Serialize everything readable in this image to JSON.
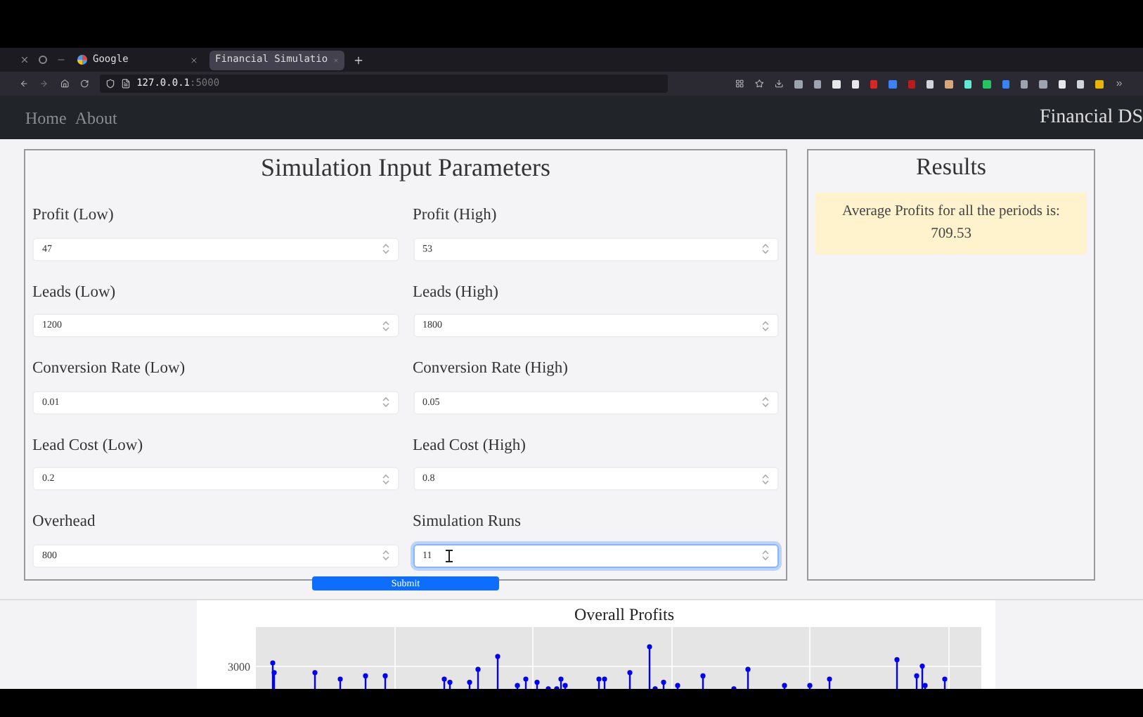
{
  "browser": {
    "tabs": [
      {
        "label": "Google",
        "selected": false
      },
      {
        "label": "Financial Simulatio",
        "selected": true
      }
    ],
    "address": {
      "host": "127.0.0.1",
      "port": ":5000"
    }
  },
  "navbar": {
    "links": [
      "Home",
      "About"
    ],
    "brand": "Financial DS"
  },
  "form": {
    "title": "Simulation Input Parameters",
    "fields": [
      {
        "label": "Profit (Low)",
        "value": "47",
        "focused": false
      },
      {
        "label": "Profit (High)",
        "value": "53",
        "focused": false
      },
      {
        "label": "Leads (Low)",
        "value": "1200",
        "focused": false
      },
      {
        "label": "Leads (High)",
        "value": "1800",
        "focused": false
      },
      {
        "label": "Conversion Rate (Low)",
        "value": "0.01",
        "focused": false
      },
      {
        "label": "Conversion Rate (High)",
        "value": "0.05",
        "focused": false
      },
      {
        "label": "Lead Cost (Low)",
        "value": "0.2",
        "focused": false
      },
      {
        "label": "Lead Cost (High)",
        "value": "0.8",
        "focused": false
      },
      {
        "label": "Overhead",
        "value": "800",
        "focused": false
      },
      {
        "label": "Simulation Runs",
        "value": "11",
        "focused": true
      }
    ],
    "submit": "Submit"
  },
  "results": {
    "title": "Results",
    "message": "Average Profits for all the periods is:",
    "value": "709.53"
  },
  "chart": {
    "title": "Overall Profits",
    "ytick": "3000"
  }
}
